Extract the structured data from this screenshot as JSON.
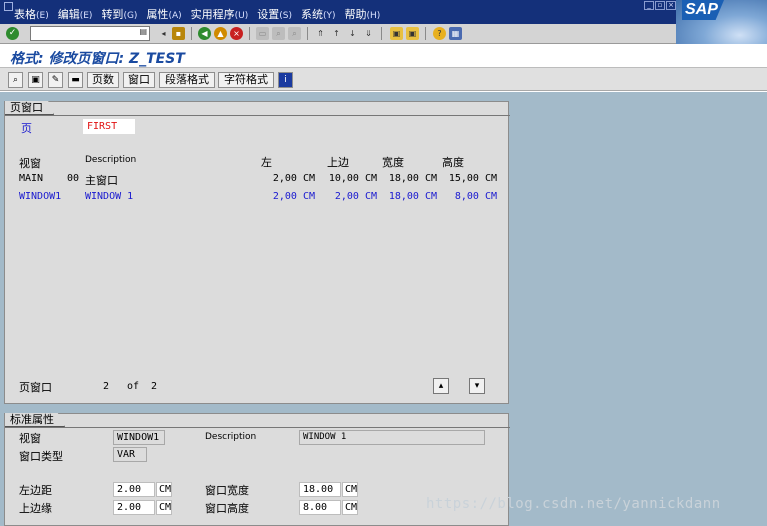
{
  "menu": {
    "items": [
      {
        "label": "表格",
        "accel": "(E)"
      },
      {
        "label": "编辑",
        "accel": "(E)"
      },
      {
        "label": "转到",
        "accel": "(G)"
      },
      {
        "label": "属性",
        "accel": "(A)"
      },
      {
        "label": "实用程序",
        "accel": "(U)"
      },
      {
        "label": "设置",
        "accel": "(S)"
      },
      {
        "label": "系统",
        "accel": "(Y)"
      },
      {
        "label": "帮助",
        "accel": "(H)"
      }
    ],
    "logo": "SAP"
  },
  "toolbar": {
    "command_value": ""
  },
  "title": "格式: 修改页窗口: Z_TEST",
  "app_toolbar": {
    "pages_label": "页数",
    "window_label": "窗口",
    "paragraph_label": "段落格式",
    "char_label": "字符格式"
  },
  "page_window_panel": {
    "tab": "页窗口",
    "page_label": "页",
    "page_value": "FIRST",
    "columns": {
      "window": "视窗",
      "description": "Description",
      "left": "左",
      "top": "上边",
      "width": "宽度",
      "height": "高度"
    },
    "rows": [
      {
        "window": "MAIN",
        "num": "00",
        "description": "主窗口",
        "left": "2,00 CM",
        "top": "10,00 CM",
        "width": "18,00 CM",
        "height": "15,00 CM"
      },
      {
        "window": "WINDOW1",
        "num": "",
        "description": "WINDOW 1",
        "left": "2,00 CM",
        "top": "2,00 CM",
        "width": "18,00 CM",
        "height": "8,00 CM"
      }
    ],
    "footer_label": "页窗口",
    "current": "2",
    "of_label": "of",
    "total": "2"
  },
  "std_attr_panel": {
    "tab": "标准属性",
    "window_label": "视窗",
    "window_value": "WINDOW1",
    "description_label": "Description",
    "description_value": "WINDOW 1",
    "window_type_label": "窗口类型",
    "window_type_value": "VAR",
    "left_margin_label": "左边距",
    "left_margin_value": "2.00",
    "left_margin_unit": "CM",
    "top_margin_label": "上边缘",
    "top_margin_value": "2.00",
    "top_margin_unit": "CM",
    "win_width_label": "窗口宽度",
    "win_width_value": "18.00",
    "win_width_unit": "CM",
    "win_height_label": "窗口高度",
    "win_height_value": "8.00",
    "win_height_unit": "CM"
  },
  "watermark": "https://blog.csdn.net/yannickdann"
}
